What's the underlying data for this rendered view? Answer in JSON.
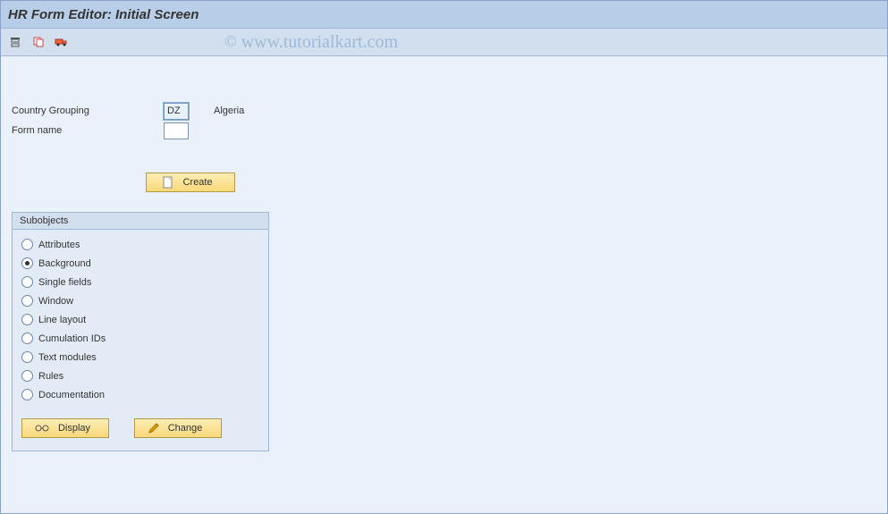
{
  "title": "HR Form Editor: Initial Screen",
  "watermark": "www.tutorialkart.com",
  "toolbar": {
    "delete_icon": "delete-icon",
    "copy_icon": "copy-icon",
    "transport_icon": "transport-icon"
  },
  "fields": {
    "country_grouping": {
      "label": "Country Grouping",
      "value": "DZ",
      "desc": "Algeria"
    },
    "form_name": {
      "label": "Form name",
      "value": ""
    }
  },
  "buttons": {
    "create": "Create",
    "display": "Display",
    "change": "Change"
  },
  "panel": {
    "title": "Subobjects",
    "options": [
      {
        "label": "Attributes",
        "checked": false
      },
      {
        "label": "Background",
        "checked": true
      },
      {
        "label": "Single fields",
        "checked": false
      },
      {
        "label": "Window",
        "checked": false
      },
      {
        "label": "Line layout",
        "checked": false
      },
      {
        "label": "Cumulation IDs",
        "checked": false
      },
      {
        "label": "Text modules",
        "checked": false
      },
      {
        "label": "Rules",
        "checked": false
      },
      {
        "label": "Documentation",
        "checked": false
      }
    ]
  }
}
